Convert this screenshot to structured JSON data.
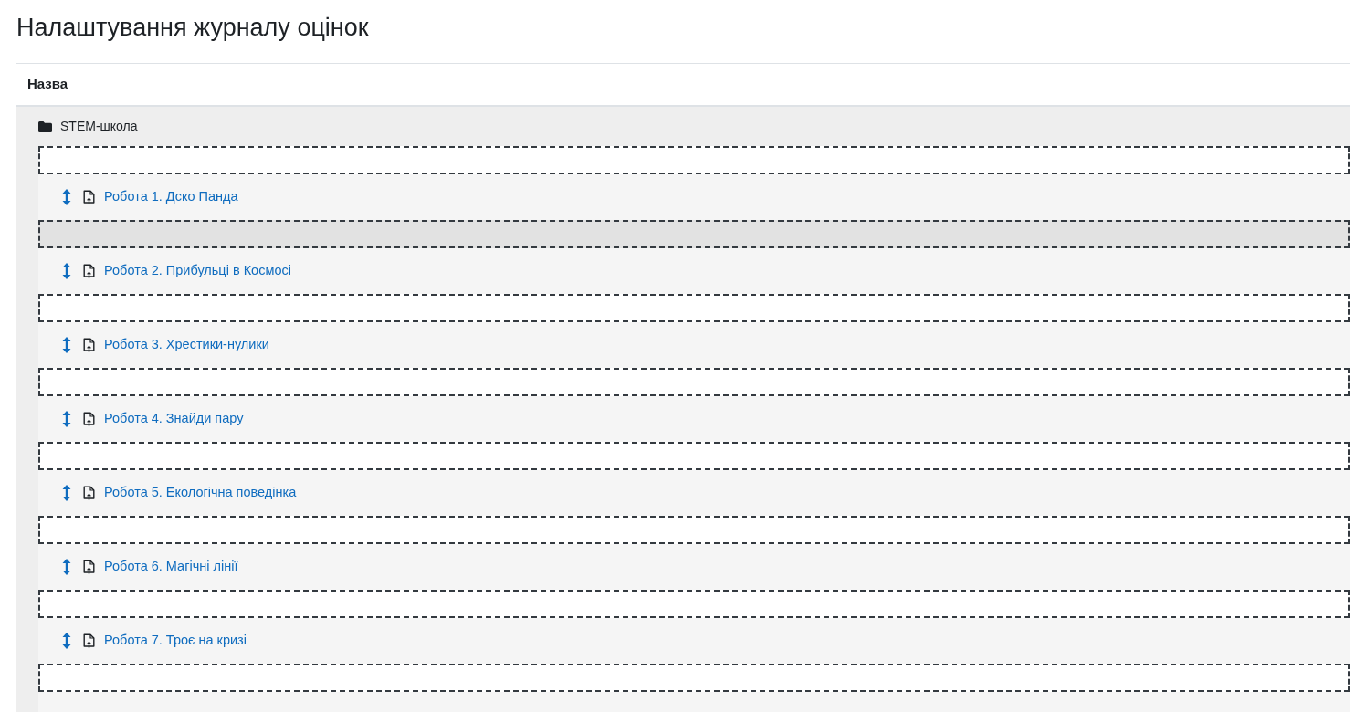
{
  "page_title": "Налаштування журналу оцінок",
  "table": {
    "columns": [
      "Назва"
    ],
    "category": {
      "name": "STEM-школа",
      "children": [
        {
          "kind": "drop_zone",
          "highlighted": false
        },
        {
          "kind": "grade_item",
          "name": "Робота 1. Дско Панда"
        },
        {
          "kind": "drop_zone",
          "highlighted": true
        },
        {
          "kind": "grade_item",
          "name": "Робота 2. Прибульці в Космосі"
        },
        {
          "kind": "drop_zone",
          "highlighted": false
        },
        {
          "kind": "grade_item",
          "name": "Робота 3. Хрестики-нулики"
        },
        {
          "kind": "drop_zone",
          "highlighted": false
        },
        {
          "kind": "grade_item",
          "name": "Робота 4. Знайди пару"
        },
        {
          "kind": "drop_zone",
          "highlighted": false
        },
        {
          "kind": "grade_item",
          "name": "Робота 5. Екологічна поведінка"
        },
        {
          "kind": "drop_zone",
          "highlighted": false
        },
        {
          "kind": "grade_item",
          "name": "Робота 6. Магічні лінії"
        },
        {
          "kind": "drop_zone",
          "highlighted": false
        },
        {
          "kind": "grade_item",
          "name": "Робота 7. Троє на кризі"
        },
        {
          "kind": "drop_zone",
          "highlighted": false
        }
      ]
    }
  }
}
